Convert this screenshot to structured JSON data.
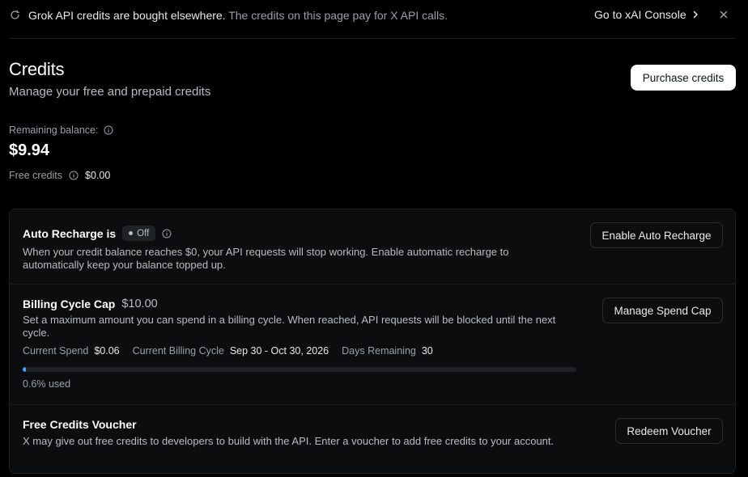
{
  "banner": {
    "strong": "Grok API credits are bought elsewhere.",
    "muted": "The credits on this page pay for X API calls.",
    "link_label": "Go to xAI Console",
    "icon": "spinner-icon"
  },
  "header": {
    "title": "Credits",
    "subtitle": "Manage your free and prepaid credits",
    "purchase_label": "Purchase credits"
  },
  "balance": {
    "remaining_label": "Remaining balance:",
    "remaining_value": "$9.94",
    "free_label": "Free credits",
    "free_value": "$0.00"
  },
  "auto_recharge": {
    "title": "Auto Recharge is",
    "status": "Off",
    "description": "When your credit balance reaches $0, your API requests will stop working. Enable automatic recharge to automatically keep your balance topped up.",
    "button_label": "Enable Auto Recharge"
  },
  "billing_cap": {
    "title": "Billing Cycle Cap",
    "amount": "$10.00",
    "description": "Set a maximum amount you can spend in a billing cycle. When reached, API requests will be blocked until the next cycle.",
    "button_label": "Manage Spend Cap",
    "current_spend_label": "Current Spend",
    "current_spend_value": "$0.06",
    "cycle_label": "Current Billing Cycle",
    "cycle_value": "Sep 30 - Oct 30, 2026",
    "days_label": "Days Remaining",
    "days_value": "30",
    "used_fraction": 0.006,
    "used_text": "0.6% used"
  },
  "voucher": {
    "title": "Free Credits Voucher",
    "description": "X may give out free credits to developers to build with the API. Enter a voucher to add free credits to your account.",
    "button_label": "Redeem Voucher"
  },
  "colors": {
    "background": "#000000",
    "accent": "#4a9eff",
    "primary_button": "#ffffff"
  }
}
